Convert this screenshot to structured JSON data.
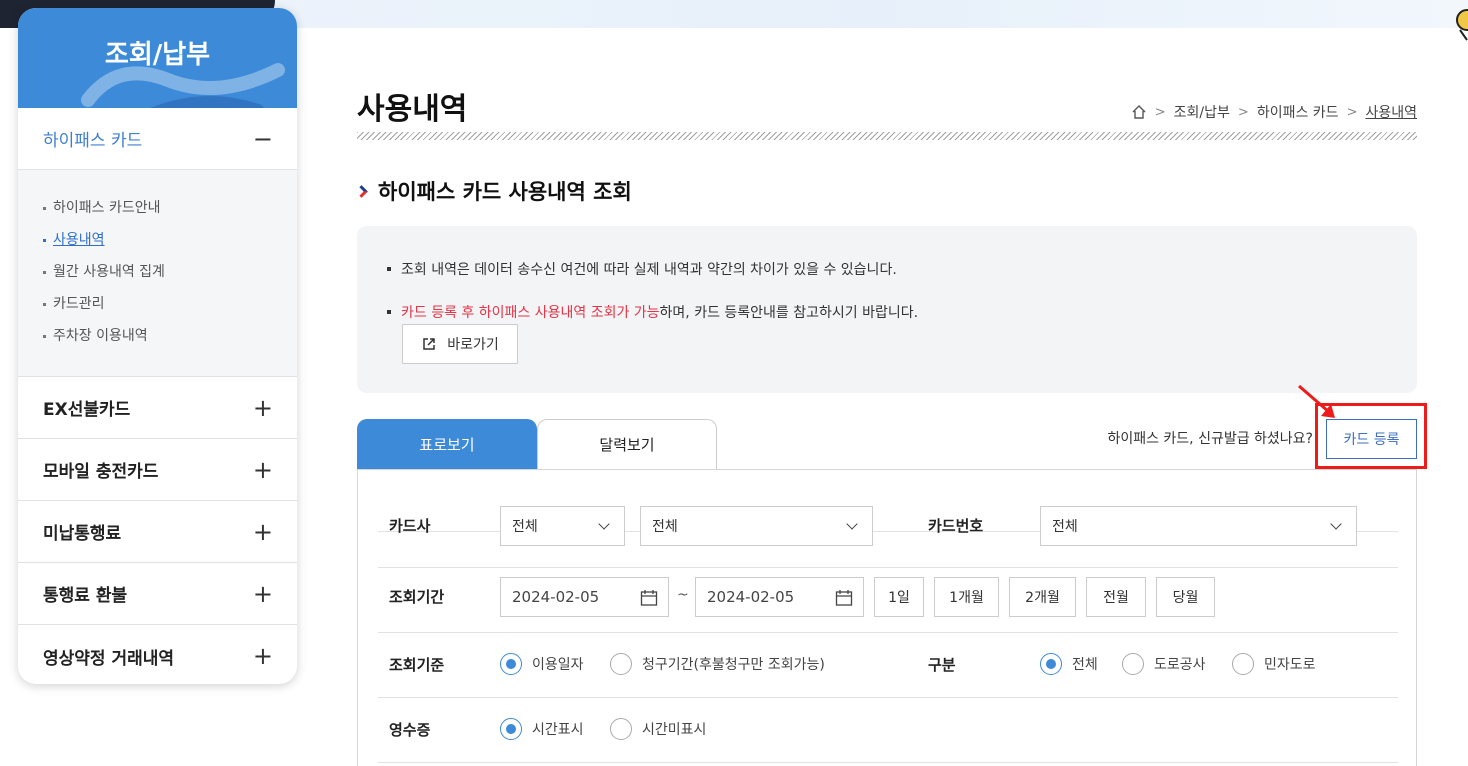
{
  "sidebar": {
    "title": "조회/납부",
    "items": [
      {
        "label": "하이패스 카드",
        "toggle": "−"
      },
      {
        "label": "EX선불카드",
        "toggle": "+"
      },
      {
        "label": "모바일 충전카드",
        "toggle": "+"
      },
      {
        "label": "미납통행료",
        "toggle": "+"
      },
      {
        "label": "통행료 환불",
        "toggle": "+"
      },
      {
        "label": "영상약정 거래내역",
        "toggle": "+"
      }
    ],
    "subitems": [
      "하이패스 카드안내",
      "사용내역",
      "월간 사용내역 집계",
      "카드관리",
      "주차장 이용내역"
    ]
  },
  "page": {
    "title": "사용내역",
    "breadcrumb": [
      "조회/납부",
      "하이패스 카드",
      "사용내역"
    ],
    "section_title": "하이패스 카드 사용내역 조회"
  },
  "notice": {
    "line1": "조회 내역은 데이터 송수신 여건에 따라 실제 내역과 약간의 차이가 있을 수 있습니다.",
    "line2_red": "카드 등록 후 하이패스 사용내역 조회가 가능",
    "line2_rest": "하며, 카드 등록안내를 참고하시기 바랍니다.",
    "goto_label": "바로가기"
  },
  "tabs": [
    "표로보기",
    "달력보기"
  ],
  "new_card_question": "하이패스 카드, 신규발급 하셨나요?",
  "card_register_label": "카드 등록",
  "form": {
    "card_company_label": "카드사",
    "card_company_value": "전체",
    "card_company_value2": "전체",
    "card_number_label": "카드번호",
    "card_number_value": "전체",
    "period_label": "조회기간",
    "date_from": "2024-02-05",
    "date_sep": "~",
    "date_to": "2024-02-05",
    "period_buttons": [
      "1일",
      "1개월",
      "2개월",
      "전월",
      "당월"
    ],
    "basis_label": "조회기준",
    "basis_options": [
      "이용일자",
      "청구기간(후불청구만 조회가능)"
    ],
    "category_label": "구분",
    "category_options": [
      "전체",
      "도로공사",
      "민자도로"
    ],
    "receipt_label": "영수증",
    "receipt_options": [
      "시간표시",
      "시간미표시"
    ]
  },
  "colors": {
    "primary": "#3d8ad8",
    "highlight": "#ee1b1b",
    "notice_red": "#e53347"
  }
}
